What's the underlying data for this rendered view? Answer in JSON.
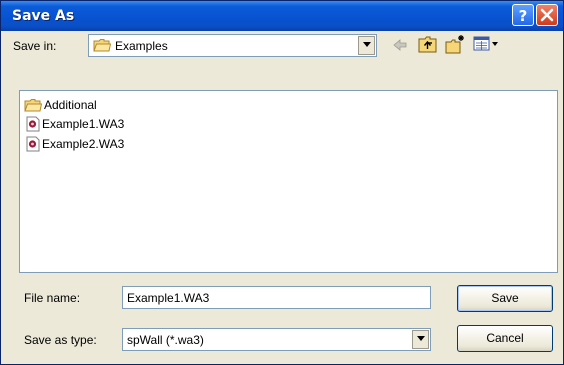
{
  "window": {
    "title": "Save As",
    "help_label": "?"
  },
  "save_in": {
    "label": "Save in:",
    "value": "Examples"
  },
  "toolbar": {
    "icons": [
      "back-arrow-icon",
      "up-one-level-icon",
      "create-new-folder-icon",
      "view-menu-icon"
    ]
  },
  "files": [
    {
      "name": "Additional",
      "icon": "folder-icon"
    },
    {
      "name": "Example1.WA3",
      "icon": "wa3-file-icon"
    },
    {
      "name": "Example2.WA3",
      "icon": "wa3-file-icon"
    }
  ],
  "file_name": {
    "label": "File name:",
    "value": "Example1.WA3"
  },
  "save_as_type": {
    "label": "Save as type:",
    "value": "spWall (*.wa3)"
  },
  "buttons": {
    "save": "Save",
    "cancel": "Cancel"
  },
  "colors": {
    "titlebar": "#0852d0",
    "dialog_bg": "#ece9d8",
    "close_button": "#cf3a1a",
    "help_button": "#2468e8"
  }
}
